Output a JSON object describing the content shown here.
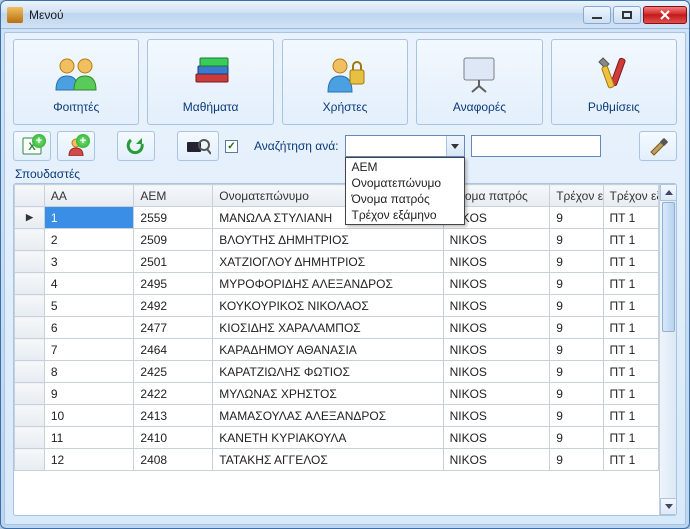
{
  "window": {
    "title": "Μενού"
  },
  "toolbar": {
    "students": "Φοιτητές",
    "courses": "Μαθήματα",
    "users": "Χρήστες",
    "reports": "Αναφορές",
    "settings": "Ρυθμίσεις"
  },
  "search": {
    "label": "Αναζήτηση ανά:",
    "options": [
      "AEM",
      "Ονοματεπώνυμο",
      "Όνομα πατρός",
      "Τρέχον εξάμηνο"
    ],
    "input_placeholder": ""
  },
  "section_label": "Σπουδαστές",
  "columns": {
    "aa": "AA",
    "aem": "AEM",
    "name": "Ονοματεπώνυμο",
    "father": "Όνομα πατρός",
    "sem": "Τρέχον εξάμηνο",
    "tsem": "Τρέχον εξάμηνο"
  },
  "rows": [
    {
      "aa": "1",
      "aem": "2559",
      "name": "ΜΑΝΩΛΑ ΣΤΥΛΙΑΝΗ",
      "father": "NIKOS",
      "sem": "9",
      "tsem": "ΠΤ 1"
    },
    {
      "aa": "2",
      "aem": "2509",
      "name": "ΒΛΟΥΤΗΣ ΔΗΜΗΤΡΙΟΣ",
      "father": "NIKOS",
      "sem": "9",
      "tsem": "ΠΤ 1"
    },
    {
      "aa": "3",
      "aem": "2501",
      "name": "ΧΑΤΖΙΟΓΛΟΥ ΔΗΜΗΤΡΙΟΣ",
      "father": "NIKOS",
      "sem": "9",
      "tsem": "ΠΤ 1"
    },
    {
      "aa": "4",
      "aem": "2495",
      "name": "ΜΥΡΟΦΟΡΙΔΗΣ ΑΛΕΞΑΝΔΡΟΣ",
      "father": "NIKOS",
      "sem": "9",
      "tsem": "ΠΤ 1"
    },
    {
      "aa": "5",
      "aem": "2492",
      "name": "ΚΟΥΚΟΥΡΙΚΟΣ ΝΙΚΟΛΑΟΣ",
      "father": "NIKOS",
      "sem": "9",
      "tsem": "ΠΤ 1"
    },
    {
      "aa": "6",
      "aem": "2477",
      "name": "ΚΙΟΣΙΔΗΣ ΧΑΡΑΛΑΜΠΟΣ",
      "father": "NIKOS",
      "sem": "9",
      "tsem": "ΠΤ 1"
    },
    {
      "aa": "7",
      "aem": "2464",
      "name": "ΚΑΡΑΔΗΜΟΥ ΑΘΑΝΑΣΙΑ",
      "father": "NIKOS",
      "sem": "9",
      "tsem": "ΠΤ 1"
    },
    {
      "aa": "8",
      "aem": "2425",
      "name": "ΚΑΡΑΤΖΙΩΛΗΣ ΦΩΤΙΟΣ",
      "father": "NIKOS",
      "sem": "9",
      "tsem": "ΠΤ 1"
    },
    {
      "aa": "9",
      "aem": "2422",
      "name": "ΜΥΛΩΝΑΣ ΧΡΗΣΤΟΣ",
      "father": "NIKOS",
      "sem": "9",
      "tsem": "ΠΤ 1"
    },
    {
      "aa": "10",
      "aem": "2413",
      "name": "ΜΑΜΑΣΟΥΛΑΣ ΑΛΕΞΑΝΔΡΟΣ",
      "father": "NIKOS",
      "sem": "9",
      "tsem": "ΠΤ 1"
    },
    {
      "aa": "11",
      "aem": "2410",
      "name": "ΚΑΝΕΤΗ ΚΥΡΙΑΚΟΥΛΑ",
      "father": "NIKOS",
      "sem": "9",
      "tsem": "ΠΤ 1"
    },
    {
      "aa": "12",
      "aem": "2408",
      "name": "ΤΑΤΑΚΗΣ ΑΓΓΕΛΟΣ",
      "father": "NIKOS",
      "sem": "9",
      "tsem": "ΠΤ 1"
    }
  ]
}
